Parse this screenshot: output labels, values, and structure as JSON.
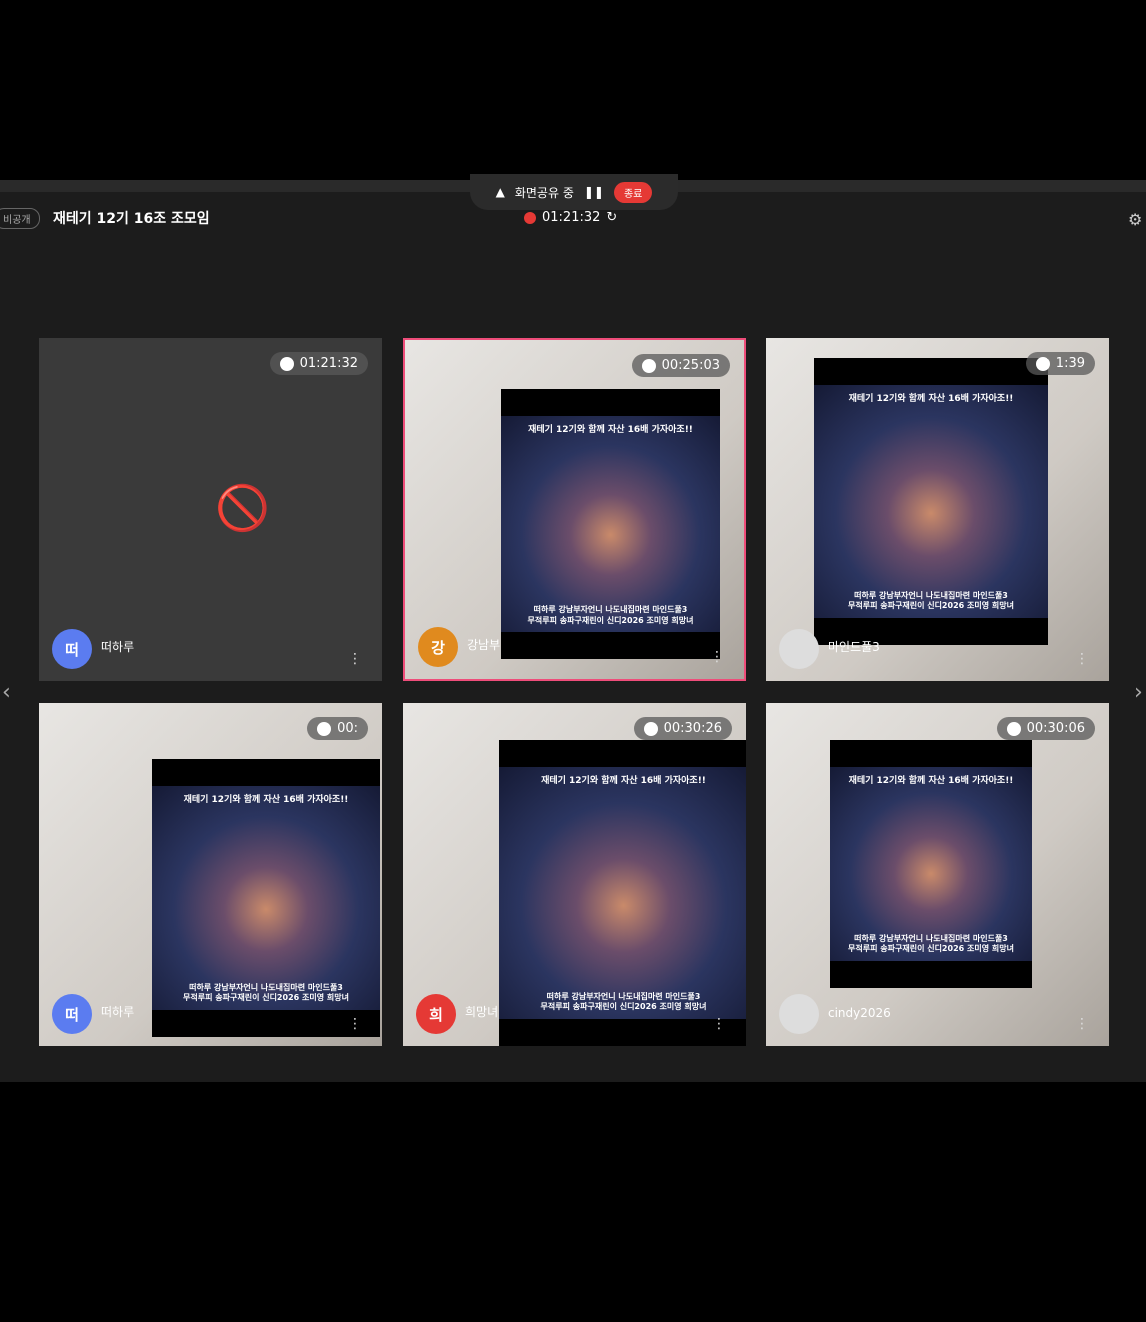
{
  "header": {
    "visibility_badge": "비공개",
    "meeting_title": "재테기 12기 16조 조모임",
    "elapsed": "01:21:32",
    "share_status": "화면공유 중",
    "stop_label": "종료"
  },
  "poster": {
    "title": "재테기 12기와 함께 자산 16배 가자아조!!",
    "line1": "떠하루 강남부자언니 나도내집마련 마인드풀3",
    "line2": "무적루피 송파구재린이 신디2026 조미영 희망녀"
  },
  "participants": [
    {
      "name": "떠하루",
      "initial": "떠",
      "timer": "01:21:32",
      "color": "#5b7cf0"
    },
    {
      "name": "강남부",
      "initial": "강",
      "timer": "00:25:03",
      "color": "#e08a1e"
    },
    {
      "name": "마인드풀3",
      "initial": "",
      "timer": "1:39",
      "color": "#ddd"
    },
    {
      "name": "떠하루",
      "initial": "떠",
      "timer": "00:",
      "color": "#5b7cf0"
    },
    {
      "name": "희망녀",
      "initial": "희",
      "timer": "00:30:26",
      "color": "#e53935"
    },
    {
      "name": "cindy2026",
      "initial": "",
      "timer": "00:30:06",
      "color": "#ddd"
    }
  ]
}
